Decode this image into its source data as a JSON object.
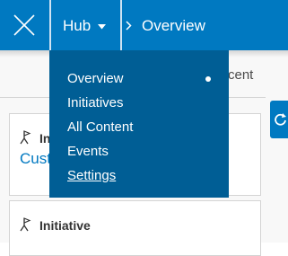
{
  "topbar": {
    "menu_button": "Hub",
    "breadcrumb_current": "Overview"
  },
  "dropdown": {
    "items": [
      {
        "label": "Overview",
        "active": true
      },
      {
        "label": "Initiatives"
      },
      {
        "label": "All Content"
      },
      {
        "label": "Events"
      },
      {
        "label": "Settings",
        "underlined": true
      }
    ]
  },
  "background": {
    "recent_text": "cent",
    "cards": [
      {
        "type_label": "In",
        "title": "Cust"
      },
      {
        "type_label": "Initiative"
      }
    ]
  },
  "colors": {
    "primary": "#0079c1",
    "menu_bg": "#005e95",
    "text_on_primary": "#ffffff"
  },
  "icons": {
    "close": "close-icon",
    "caret": "caret-down-icon",
    "breadcrumb_separator": "chevron-right-icon",
    "card_type": "flag-icon",
    "side_tab": "refresh-icon"
  }
}
